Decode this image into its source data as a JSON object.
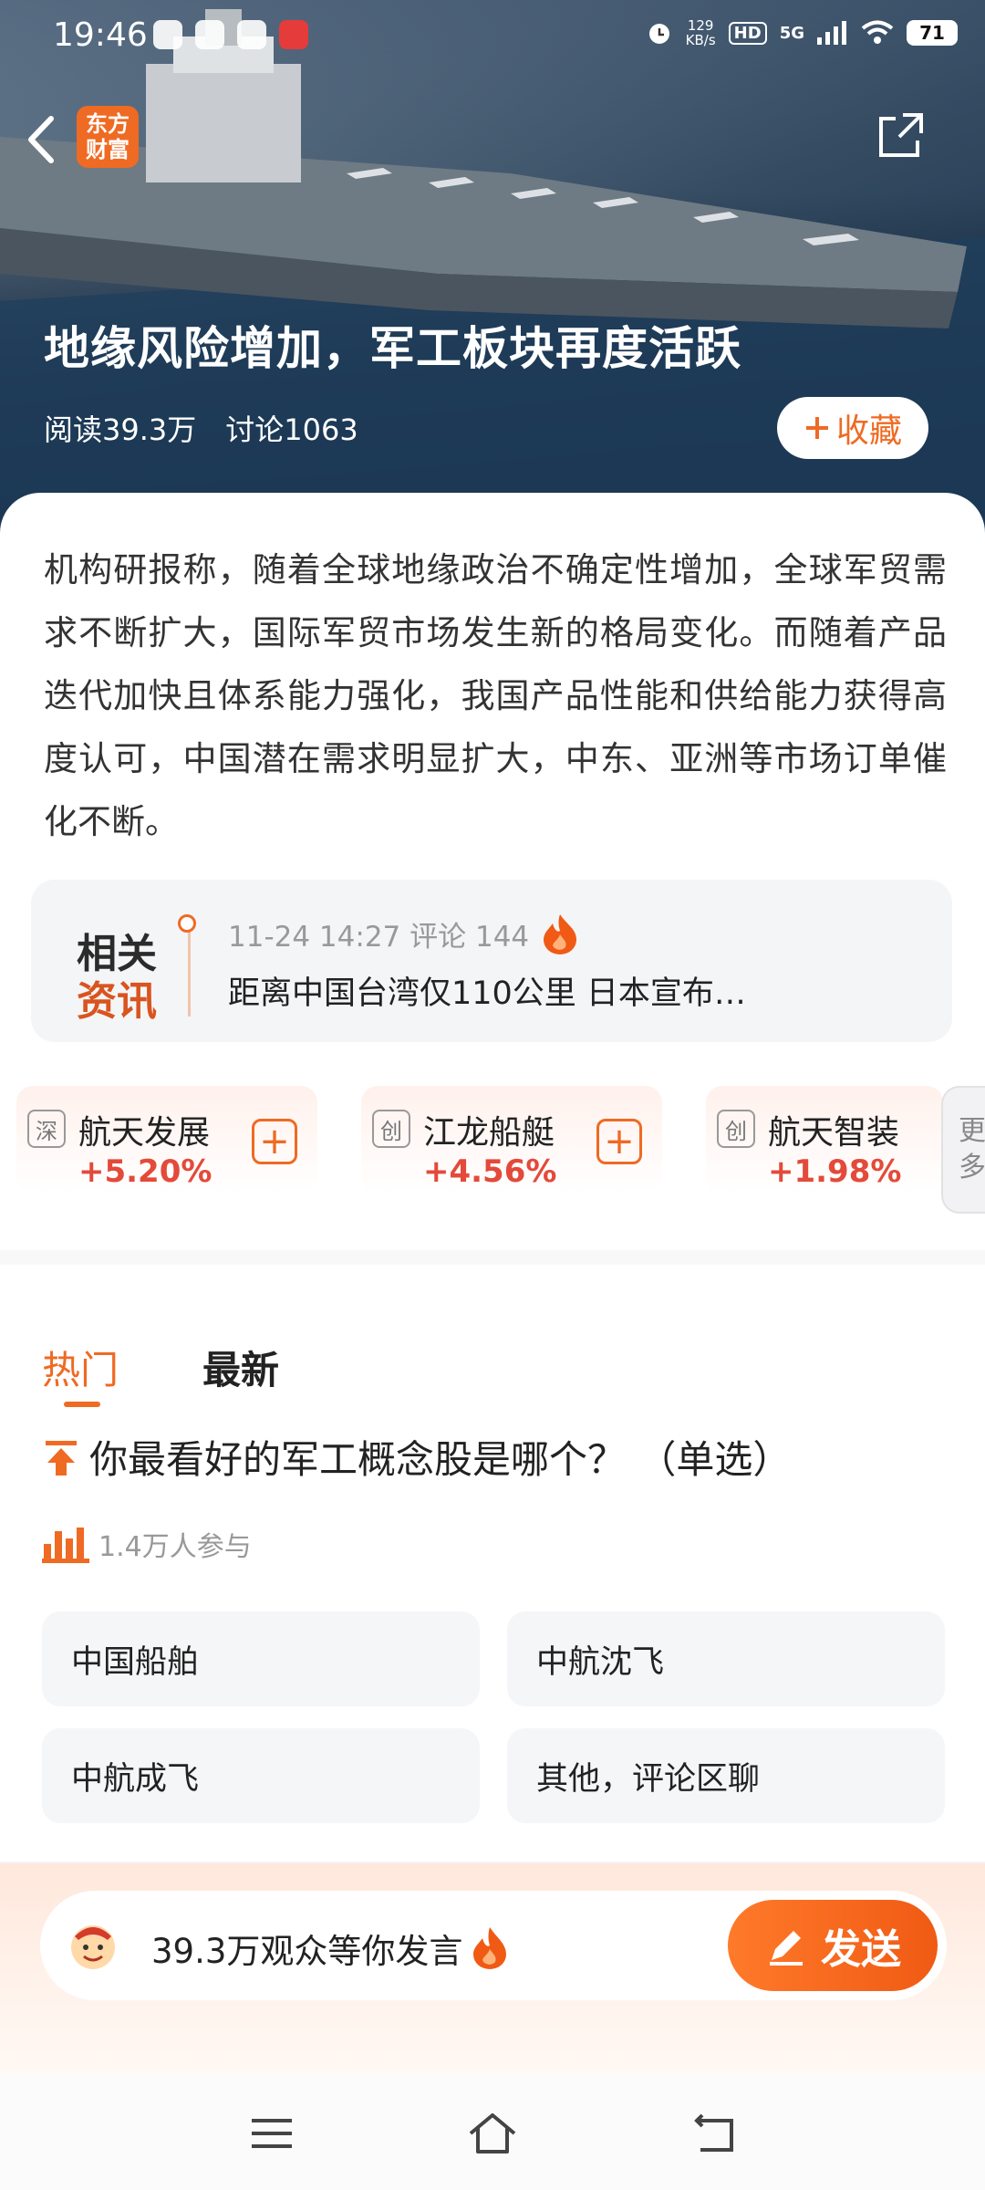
{
  "status_bar": {
    "time": "19:46",
    "net_speed_value": "129",
    "net_speed_unit": "KB/s",
    "hd": "HD",
    "signal": "5G",
    "battery": "71"
  },
  "hero": {
    "logo_line1": "东方",
    "logo_line2": "财富",
    "title": "地缘风险增加，军工板块再度活跃",
    "reads": "阅读39.3万",
    "discussions": "讨论1063",
    "favorite_label": "收藏"
  },
  "intro": "机构研报称，随着全球地缘政治不确定性增加，全球军贸需求不断扩大，国际军贸市场发生新的格局变化。而随着产品迭代加快且体系能力强化，我国产品性能和供给能力获得高度认可，中国潜在需求明显扩大，中东、亚洲等市场订单催化不断。",
  "related": {
    "tag_line1": "相关",
    "tag_line2": "资讯",
    "meta": "11-24 14:27 评论 144",
    "headline": "距离中国台湾仅110公里 日本宣布…"
  },
  "stocks": [
    {
      "badge": "深",
      "name": "航天发展",
      "change": "+5.20%"
    },
    {
      "badge": "创",
      "name": "江龙船艇",
      "change": "+4.56%"
    },
    {
      "badge": "创",
      "name": "航天智装",
      "change": "+1.98%"
    }
  ],
  "more_label_1": "更",
  "more_label_2": "多",
  "tabs": {
    "hot": "热门",
    "latest": "最新"
  },
  "poll": {
    "question": "你最看好的军工概念股是哪个？ （单选）",
    "participants": "1.4万人参与",
    "options": [
      "中国船舶",
      "中航沈飞",
      "中航成飞",
      "其他，评论区聊"
    ]
  },
  "comment": {
    "placeholder": "39.3万观众等你发言",
    "send_label": "发送"
  },
  "colors": {
    "accent": "#ef6a23",
    "up": "#e34a3a"
  }
}
